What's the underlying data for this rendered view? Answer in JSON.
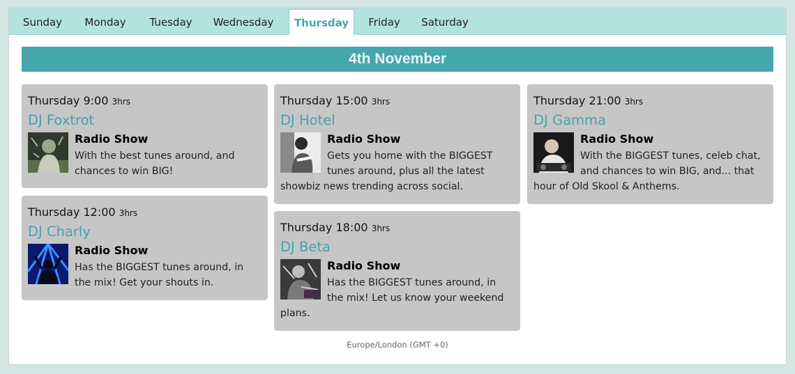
{
  "tabs": [
    "Sunday",
    "Monday",
    "Tuesday",
    "Wednesday",
    "Thursday",
    "Friday",
    "Saturday"
  ],
  "active_tab": "Thursday",
  "date_heading": "4th November",
  "accent_color": "#46a6ae",
  "shows": [
    {
      "time": "Thursday 9:00",
      "duration": "3hrs",
      "dj": "DJ Foxtrot",
      "title": "Radio Show",
      "description": "With the best tunes around, and chances to win BIG!",
      "icon": "dj-foxtrot-photo"
    },
    {
      "time": "Thursday 12:00",
      "duration": "3hrs",
      "dj": "DJ Charly",
      "title": "Radio Show",
      "description": "Has the BIGGEST tunes around, in the mix! Get your shouts in.",
      "icon": "dj-charly-photo"
    },
    {
      "time": "Thursday 15:00",
      "duration": "3hrs",
      "dj": "DJ Hotel",
      "title": "Radio Show",
      "description": "Gets you home with the BIGGEST tunes around, plus all the latest showbiz news trending across social.",
      "icon": "dj-hotel-photo"
    },
    {
      "time": "Thursday 18:00",
      "duration": "3hrs",
      "dj": "DJ Beta",
      "title": "Radio Show",
      "description": "Has the BIGGEST tunes around, in the mix! Let us know your weekend plans.",
      "icon": "dj-beta-photo"
    },
    {
      "time": "Thursday 21:00",
      "duration": "3hrs",
      "dj": "DJ Gamma",
      "title": "Radio Show",
      "description": "With the BIGGEST tunes, celeb chat, and chances to win BIG, and... that hour of Old Skool & Anthems.",
      "icon": "dj-gamma-photo"
    }
  ],
  "timezone": "Europe/London (GMT +0)"
}
